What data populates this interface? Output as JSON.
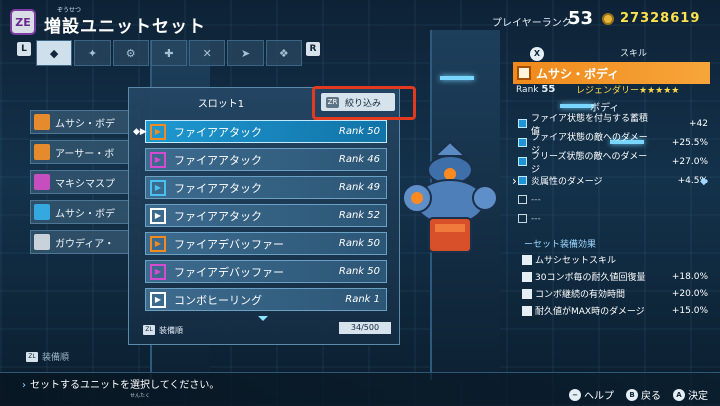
{
  "header": {
    "logo_text": "ZE",
    "title_ruby": "ぞうせつ",
    "title": "増設ユニットセット",
    "rank_label": "プレイヤーランク",
    "rank_value": "53",
    "money": "27328619"
  },
  "category_tabs": {
    "left_button": "L",
    "right_button": "R",
    "tabs": [
      "",
      "",
      "",
      "",
      "",
      "",
      ""
    ]
  },
  "left_list": {
    "items": [
      {
        "label": "ムサシ・ボデ",
        "icon_color": "#e68a2e"
      },
      {
        "label": "アーサー・ボ",
        "icon_color": "#e68a2e"
      },
      {
        "label": "マキシマスプ",
        "icon_color": "#c64fbf"
      },
      {
        "label": "ムサシ・ボデ",
        "icon_color": "#34a9e0"
      },
      {
        "label": "ガウディア・",
        "icon_color": "#c9d2da"
      }
    ]
  },
  "slot_panel": {
    "title": "スロット1",
    "filter_button_icon": "ZR",
    "filter_label": "絞り込み",
    "rows": [
      {
        "name": "ファイアアタック",
        "rank": "Rank 50",
        "icon_color": "#f28a1e",
        "icon": "sword-icon",
        "selected": true
      },
      {
        "name": "ファイアアタック",
        "rank": "Rank 46",
        "icon_color": "#d64ad0",
        "icon": "sword-icon",
        "selected": false
      },
      {
        "name": "ファイアアタック",
        "rank": "Rank 49",
        "icon_color": "#47c2f0",
        "icon": "sword-icon",
        "selected": false
      },
      {
        "name": "ファイアアタック",
        "rank": "Rank 52",
        "icon_color": "#ffffff",
        "icon": "sword-icon",
        "selected": false
      },
      {
        "name": "ファイアデバッファー",
        "rank": "Rank 50",
        "icon_color": "#f28a1e",
        "icon": "debuff-icon",
        "selected": false
      },
      {
        "name": "ファイアデバッファー",
        "rank": "Rank 50",
        "icon_color": "#d64ad0",
        "icon": "debuff-icon",
        "selected": false
      },
      {
        "name": "コンボヒーリング",
        "rank": "Rank  1",
        "icon_color": "#ffffff",
        "icon": "heal-icon",
        "selected": false
      }
    ],
    "footer_button": "ZL",
    "footer_label": "装備順",
    "count": "34/500"
  },
  "unit_info": {
    "x_button": "X",
    "skill_label": "スキル",
    "unit_name": "ムサシ・ボディ",
    "rarity": "レジェンダリー★★★★★",
    "rank_label": "Rank",
    "rank_value": "55",
    "body_label": "ボディ",
    "stats": [
      {
        "name": "ファイア状態を付与する蓄積値",
        "value": "+42",
        "icon": "filled"
      },
      {
        "name": "ファイア状態の敵へのダメージ",
        "value": "+25.5%",
        "icon": "filled"
      },
      {
        "name": "フリーズ状態の敵へのダメージ",
        "value": "+27.0%",
        "icon": "filled"
      },
      {
        "name": "炎属性のダメージ",
        "value": "+4.5%",
        "icon": "filled"
      },
      {
        "name": "---",
        "value": "",
        "icon": "hollow"
      },
      {
        "name": "---",
        "value": "",
        "icon": "hollow"
      }
    ],
    "set_effect_label": "ーセット装備効果",
    "set_stats": [
      {
        "name": "ムサシセットスキル",
        "value": ""
      },
      {
        "name": "30コンボ毎の耐久値回復量",
        "value": "+18.0%"
      },
      {
        "name": "コンボ継続の有効時間",
        "value": "+20.0%"
      },
      {
        "name": "耐久値がMAX時のダメージ",
        "value": "+15.0%"
      }
    ]
  },
  "bottom": {
    "zl_button": "ZL",
    "zl_label": "装備順",
    "hint": "セットするユニットを選択してください。",
    "hint_ruby": "せんたく",
    "buttons": [
      {
        "key": "−",
        "label": "ヘルプ"
      },
      {
        "key": "B",
        "label": "戻る"
      },
      {
        "key": "A",
        "label": "決定"
      }
    ]
  }
}
